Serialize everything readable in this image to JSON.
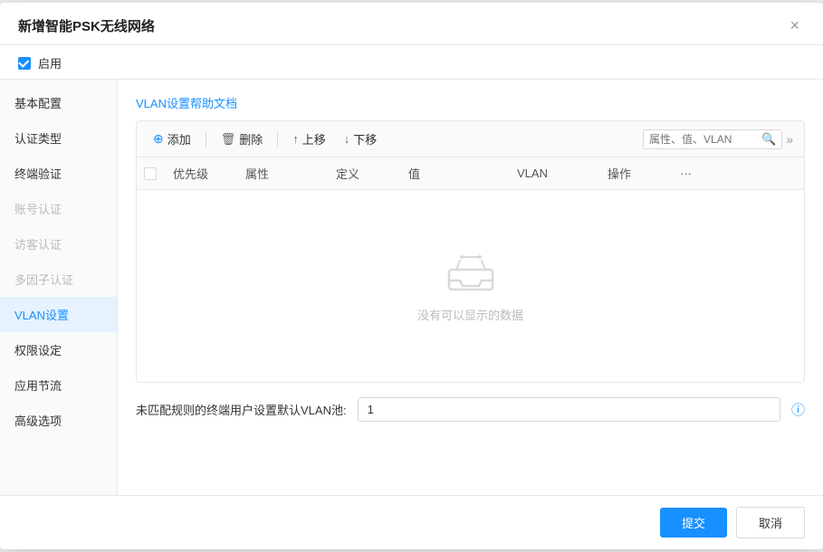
{
  "dialog": {
    "title": "新增智能PSK无线网络",
    "close_label": "×"
  },
  "enable": {
    "label": "启用",
    "checked": true
  },
  "sidebar": {
    "items": [
      {
        "key": "basic",
        "label": "基本配置",
        "active": false,
        "disabled": false
      },
      {
        "key": "auth-type",
        "label": "认证类型",
        "active": false,
        "disabled": false
      },
      {
        "key": "terminal-auth",
        "label": "终端验证",
        "active": false,
        "disabled": false
      },
      {
        "key": "account-auth",
        "label": "账号认证",
        "active": false,
        "disabled": true
      },
      {
        "key": "guest-auth",
        "label": "访客认证",
        "active": false,
        "disabled": true
      },
      {
        "key": "mfa",
        "label": "多因子认证",
        "active": false,
        "disabled": true
      },
      {
        "key": "vlan",
        "label": "VLAN设置",
        "active": true,
        "disabled": false
      },
      {
        "key": "permissions",
        "label": "权限设定",
        "active": false,
        "disabled": false
      },
      {
        "key": "app-qos",
        "label": "应用节流",
        "active": false,
        "disabled": false
      },
      {
        "key": "advanced",
        "label": "高级选项",
        "active": false,
        "disabled": false
      }
    ]
  },
  "main": {
    "help_link": "VLAN设置帮助文档",
    "toolbar": {
      "add_label": "添加",
      "delete_label": "删除",
      "move_up_label": "上移",
      "move_down_label": "下移",
      "search_placeholder": "属性、值、VLAN"
    },
    "table": {
      "columns": [
        "",
        "优先级",
        "属性",
        "定义",
        "值",
        "VLAN",
        "操作",
        "···"
      ],
      "empty_text": "没有可以显示的数据"
    },
    "bottom": {
      "label": "未匹配规则的终端用户设置默认VLAN池:",
      "value": "1"
    }
  },
  "footer": {
    "submit_label": "提交",
    "cancel_label": "取消"
  }
}
